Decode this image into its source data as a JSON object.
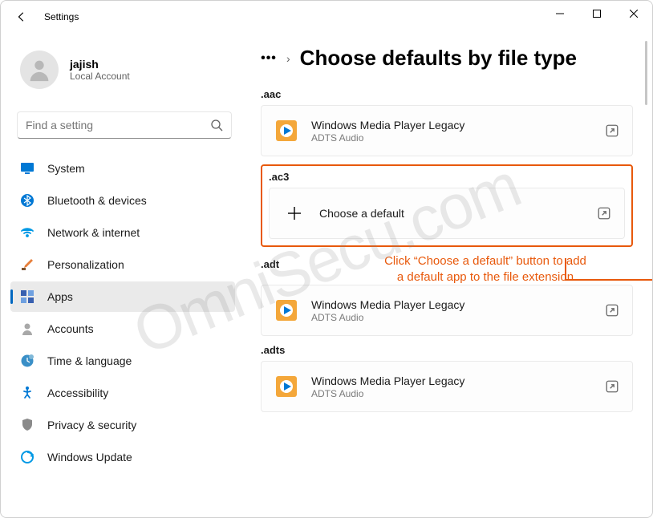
{
  "window": {
    "title": "Settings"
  },
  "user": {
    "name": "jajish",
    "subtitle": "Local Account"
  },
  "search": {
    "placeholder": "Find a setting"
  },
  "nav": {
    "items": [
      {
        "label": "System",
        "icon": "monitor",
        "color": "#0078d4"
      },
      {
        "label": "Bluetooth & devices",
        "icon": "bluetooth",
        "color": "#0078d4"
      },
      {
        "label": "Network & internet",
        "icon": "wifi",
        "color": "#0099e5"
      },
      {
        "label": "Personalization",
        "icon": "brush",
        "color": "#e77f3a"
      },
      {
        "label": "Apps",
        "icon": "apps",
        "color": "#3860b0",
        "active": true
      },
      {
        "label": "Accounts",
        "icon": "person",
        "color": "#6b6b6b"
      },
      {
        "label": "Time & language",
        "icon": "clock",
        "color": "#3a8fc7"
      },
      {
        "label": "Accessibility",
        "icon": "accessibility",
        "color": "#0078d4"
      },
      {
        "label": "Privacy & security",
        "icon": "shield",
        "color": "#6b6b6b"
      },
      {
        "label": "Windows Update",
        "icon": "update",
        "color": "#0099e5"
      }
    ]
  },
  "breadcrumb": {
    "title": "Choose defaults by file type"
  },
  "sections": [
    {
      "ext": ".aac",
      "app": "Windows Media Player Legacy",
      "sub": "ADTS Audio",
      "icon": "wmp"
    },
    {
      "ext": ".ac3",
      "app": "Choose a default",
      "sub": "",
      "icon": "plus",
      "highlighted": true
    },
    {
      "ext": ".adt",
      "app": "Windows Media Player Legacy",
      "sub": "ADTS Audio",
      "icon": "wmp"
    },
    {
      "ext": ".adts",
      "app": "Windows Media Player Legacy",
      "sub": "ADTS Audio",
      "icon": "wmp"
    }
  ],
  "annotation": {
    "line1": "Click “Choose a default” button to add",
    "line2": "a default app to the file extension"
  },
  "watermark": "OmniSecu.com"
}
